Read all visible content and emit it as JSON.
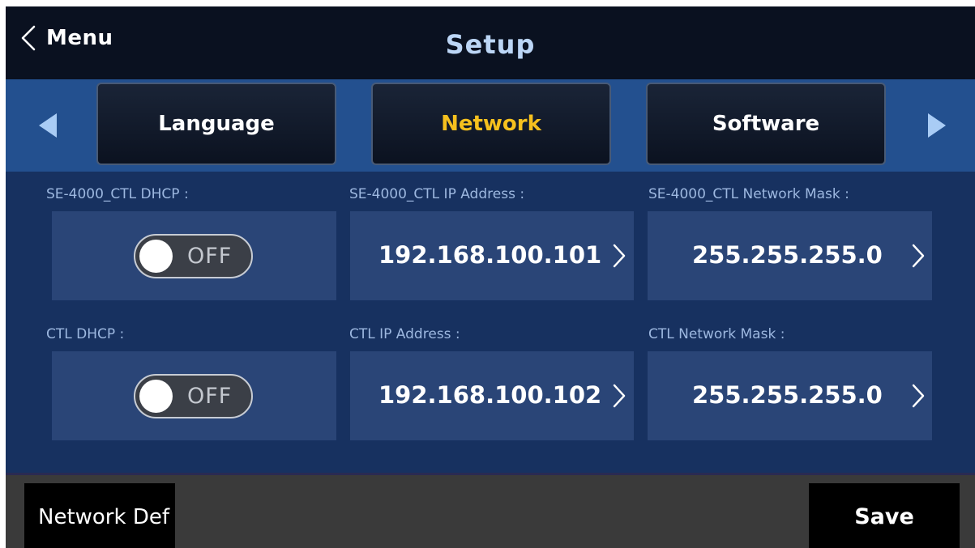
{
  "header": {
    "back_label": "Menu",
    "back_icon": "chevron-left-icon",
    "title": "Setup"
  },
  "tabs": [
    {
      "label": "Language",
      "active": false
    },
    {
      "label": "Network",
      "active": true
    },
    {
      "label": "Software",
      "active": false
    }
  ],
  "tab_nav": {
    "prev_icon": "triangle-left-icon",
    "next_icon": "triangle-right-icon"
  },
  "settings": {
    "se_dhcp": {
      "label": "SE-4000_CTL DHCP :",
      "state": "OFF"
    },
    "se_ip": {
      "label": "SE-4000_CTL IP Address :",
      "value": "192.168.100.101"
    },
    "se_mask": {
      "label": "SE-4000_CTL Network Mask :",
      "value": "255.255.255.0"
    },
    "ctl_dhcp": {
      "label": "CTL DHCP :",
      "state": "OFF"
    },
    "ctl_ip": {
      "label": "CTL IP Address :",
      "value": "192.168.100.102"
    },
    "ctl_mask": {
      "label": "CTL Network Mask :",
      "value": "255.255.255.0"
    }
  },
  "footer": {
    "default_label": "Network Def",
    "save_label": "Save"
  },
  "colors": {
    "header_bg": "#0a1120",
    "title": "#bcd6f6",
    "tabbar_bg": "#23508f",
    "active_tab_text": "#f5c01e",
    "content_bg": "#173160",
    "tile_bg": "#2a4577",
    "label_text": "#9db8e0",
    "footer_bg": "#3a3a3a"
  }
}
